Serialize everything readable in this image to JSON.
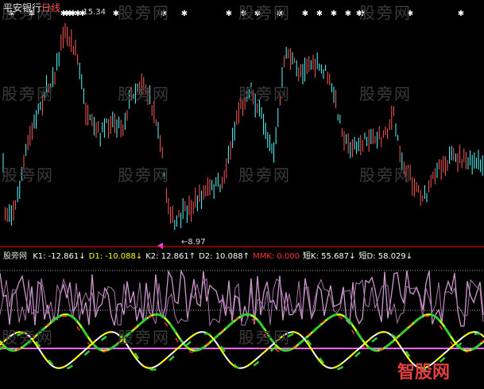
{
  "header": {
    "stock_name": "平安银行",
    "period": "日线"
  },
  "price_chart": {
    "high_label": "15.34",
    "low_label": "8.97"
  },
  "indicator": {
    "name": "股旁网",
    "values": [
      {
        "label": "K1:",
        "value": "-12.861",
        "arrow": "↓",
        "color": "#ffffff"
      },
      {
        "label": "D1:",
        "value": "-10.088",
        "arrow": "↓",
        "color": "#ffff00"
      },
      {
        "label": "K2:",
        "value": "12.861",
        "arrow": "↑",
        "color": "#ffffff"
      },
      {
        "label": "D2:",
        "value": "10.088",
        "arrow": "↑",
        "color": "#ffffff"
      },
      {
        "label": "MMK:",
        "value": "0.000",
        "arrow": "",
        "color": "#ff3030"
      },
      {
        "label": "短K:",
        "value": "55.687",
        "arrow": "↓",
        "color": "#ffffff"
      },
      {
        "label": "短D:",
        "value": "58.029",
        "arrow": "↓",
        "color": "#ffffff"
      }
    ]
  },
  "watermark": "股旁网",
  "logo_text": "智股网",
  "colors": {
    "up": "#ff5a5a",
    "down": "#55ffff",
    "star": "#ffffff",
    "divider": "#ff0000",
    "line_white": "#ffffff",
    "line_yellow": "#ffff00",
    "line_green": "#33cc33",
    "line_red": "#ff3030",
    "line_lavender": "#cc99cc",
    "line_magenta": "#ff66ff"
  }
}
